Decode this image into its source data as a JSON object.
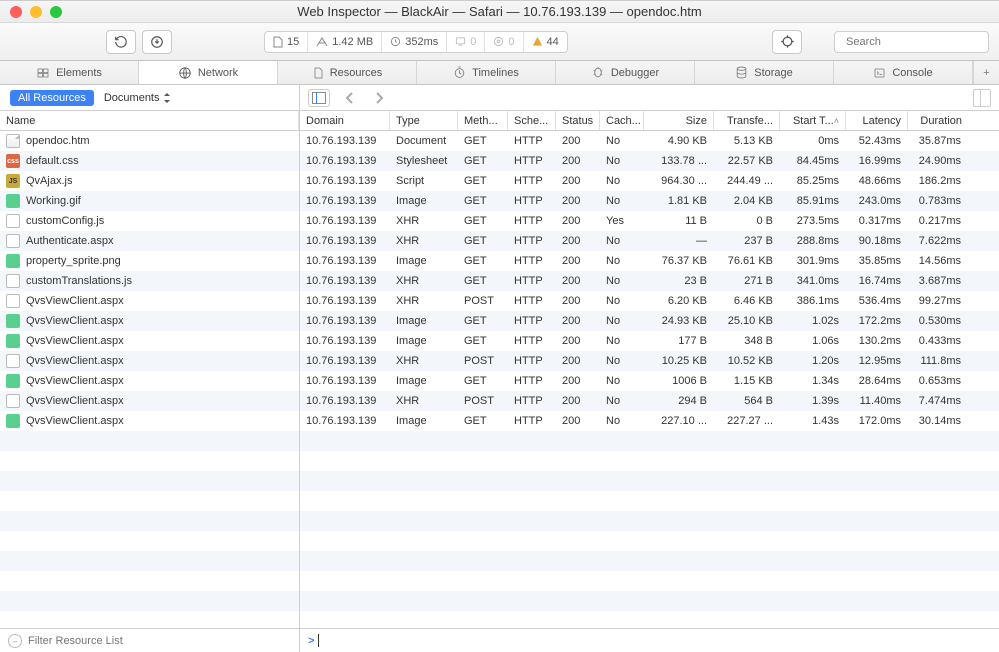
{
  "window": {
    "title": "Web Inspector — BlackAir — Safari — 10.76.193.139 — opendoc.htm"
  },
  "toolbar": {
    "docs_count": "15",
    "total_size": "1.42 MB",
    "total_time": "352ms",
    "msg1": "0",
    "msg2": "0",
    "warnings": "44",
    "search_placeholder": "Search"
  },
  "tabs": [
    {
      "id": "elements",
      "label": "Elements"
    },
    {
      "id": "network",
      "label": "Network"
    },
    {
      "id": "resources",
      "label": "Resources"
    },
    {
      "id": "timelines",
      "label": "Timelines"
    },
    {
      "id": "debugger",
      "label": "Debugger"
    },
    {
      "id": "storage",
      "label": "Storage"
    },
    {
      "id": "console",
      "label": "Console"
    }
  ],
  "filter": {
    "chip": "All Resources",
    "select": "Documents"
  },
  "columns": {
    "name": "Name",
    "domain": "Domain",
    "type": "Type",
    "method": "Meth...",
    "scheme": "Sche...",
    "status": "Status",
    "cached": "Cach...",
    "size": "Size",
    "transferred": "Transfe...",
    "start": "Start T...",
    "latency": "Latency",
    "duration": "Duration"
  },
  "footer": {
    "filter_placeholder": "Filter Resource List",
    "prompt": ">"
  },
  "rows": [
    {
      "name": "opendoc.htm",
      "icon": "doc",
      "domain": "10.76.193.139",
      "type": "Document",
      "method": "GET",
      "scheme": "HTTP",
      "status": "200",
      "cached": "No",
      "size": "4.90 KB",
      "transfer": "5.13 KB",
      "start": "0ms",
      "latency": "52.43ms",
      "duration": "35.87ms"
    },
    {
      "name": "default.css",
      "icon": "css",
      "domain": "10.76.193.139",
      "type": "Stylesheet",
      "method": "GET",
      "scheme": "HTTP",
      "status": "200",
      "cached": "No",
      "size": "133.78 ...",
      "transfer": "22.57 KB",
      "start": "84.45ms",
      "latency": "16.99ms",
      "duration": "24.90ms"
    },
    {
      "name": "QvAjax.js",
      "icon": "js",
      "domain": "10.76.193.139",
      "type": "Script",
      "method": "GET",
      "scheme": "HTTP",
      "status": "200",
      "cached": "No",
      "size": "964.30 ...",
      "transfer": "244.49 ...",
      "start": "85.25ms",
      "latency": "48.66ms",
      "duration": "186.2ms"
    },
    {
      "name": "Working.gif",
      "icon": "img",
      "domain": "10.76.193.139",
      "type": "Image",
      "method": "GET",
      "scheme": "HTTP",
      "status": "200",
      "cached": "No",
      "size": "1.81 KB",
      "transfer": "2.04 KB",
      "start": "85.91ms",
      "latency": "243.0ms",
      "duration": "0.783ms"
    },
    {
      "name": "customConfig.js",
      "icon": "xhr",
      "domain": "10.76.193.139",
      "type": "XHR",
      "method": "GET",
      "scheme": "HTTP",
      "status": "200",
      "cached": "Yes",
      "size": "11 B",
      "transfer": "0 B",
      "start": "273.5ms",
      "latency": "0.317ms",
      "duration": "0.217ms"
    },
    {
      "name": "Authenticate.aspx",
      "icon": "xhr",
      "domain": "10.76.193.139",
      "type": "XHR",
      "method": "GET",
      "scheme": "HTTP",
      "status": "200",
      "cached": "No",
      "size": "—",
      "transfer": "237 B",
      "start": "288.8ms",
      "latency": "90.18ms",
      "duration": "7.622ms"
    },
    {
      "name": "property_sprite.png",
      "icon": "img",
      "domain": "10.76.193.139",
      "type": "Image",
      "method": "GET",
      "scheme": "HTTP",
      "status": "200",
      "cached": "No",
      "size": "76.37 KB",
      "transfer": "76.61 KB",
      "start": "301.9ms",
      "latency": "35.85ms",
      "duration": "14.56ms"
    },
    {
      "name": "customTranslations.js",
      "icon": "xhr",
      "domain": "10.76.193.139",
      "type": "XHR",
      "method": "GET",
      "scheme": "HTTP",
      "status": "200",
      "cached": "No",
      "size": "23 B",
      "transfer": "271 B",
      "start": "341.0ms",
      "latency": "16.74ms",
      "duration": "3.687ms"
    },
    {
      "name": "QvsViewClient.aspx",
      "icon": "xhr",
      "domain": "10.76.193.139",
      "type": "XHR",
      "method": "POST",
      "scheme": "HTTP",
      "status": "200",
      "cached": "No",
      "size": "6.20 KB",
      "transfer": "6.46 KB",
      "start": "386.1ms",
      "latency": "536.4ms",
      "duration": "99.27ms"
    },
    {
      "name": "QvsViewClient.aspx",
      "icon": "img",
      "domain": "10.76.193.139",
      "type": "Image",
      "method": "GET",
      "scheme": "HTTP",
      "status": "200",
      "cached": "No",
      "size": "24.93 KB",
      "transfer": "25.10 KB",
      "start": "1.02s",
      "latency": "172.2ms",
      "duration": "0.530ms"
    },
    {
      "name": "QvsViewClient.aspx",
      "icon": "img",
      "domain": "10.76.193.139",
      "type": "Image",
      "method": "GET",
      "scheme": "HTTP",
      "status": "200",
      "cached": "No",
      "size": "177 B",
      "transfer": "348 B",
      "start": "1.06s",
      "latency": "130.2ms",
      "duration": "0.433ms"
    },
    {
      "name": "QvsViewClient.aspx",
      "icon": "xhr",
      "domain": "10.76.193.139",
      "type": "XHR",
      "method": "POST",
      "scheme": "HTTP",
      "status": "200",
      "cached": "No",
      "size": "10.25 KB",
      "transfer": "10.52 KB",
      "start": "1.20s",
      "latency": "12.95ms",
      "duration": "111.8ms"
    },
    {
      "name": "QvsViewClient.aspx",
      "icon": "img",
      "domain": "10.76.193.139",
      "type": "Image",
      "method": "GET",
      "scheme": "HTTP",
      "status": "200",
      "cached": "No",
      "size": "1006 B",
      "transfer": "1.15 KB",
      "start": "1.34s",
      "latency": "28.64ms",
      "duration": "0.653ms"
    },
    {
      "name": "QvsViewClient.aspx",
      "icon": "xhr",
      "domain": "10.76.193.139",
      "type": "XHR",
      "method": "POST",
      "scheme": "HTTP",
      "status": "200",
      "cached": "No",
      "size": "294 B",
      "transfer": "564 B",
      "start": "1.39s",
      "latency": "11.40ms",
      "duration": "7.474ms"
    },
    {
      "name": "QvsViewClient.aspx",
      "icon": "img",
      "domain": "10.76.193.139",
      "type": "Image",
      "method": "GET",
      "scheme": "HTTP",
      "status": "200",
      "cached": "No",
      "size": "227.10 ...",
      "transfer": "227.27 ...",
      "start": "1.43s",
      "latency": "172.0ms",
      "duration": "30.14ms"
    }
  ]
}
